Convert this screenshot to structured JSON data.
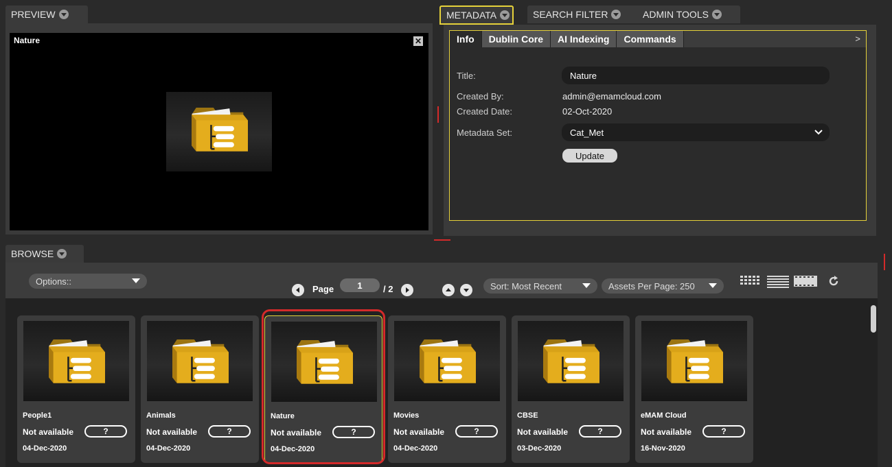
{
  "preview": {
    "tab_label": "PREVIEW",
    "asset_title": "Nature",
    "close_glyph": "✕"
  },
  "right_tabs": [
    {
      "label": "METADATA"
    },
    {
      "label": "SEARCH FILTER"
    },
    {
      "label": "ADMIN TOOLS"
    }
  ],
  "metadata": {
    "tabs": [
      {
        "label": "Info"
      },
      {
        "label": "Dublin Core"
      },
      {
        "label": "AI Indexing"
      },
      {
        "label": "Commands"
      }
    ],
    "more_arrow": ">",
    "fields": {
      "title_label": "Title:",
      "title_value": "Nature",
      "created_by_label": "Created By:",
      "created_by_value": "admin@emamcloud.com",
      "created_date_label": "Created Date:",
      "created_date_value": "02-Oct-2020",
      "metadata_set_label": "Metadata Set:",
      "metadata_set_value": "Cat_Met"
    },
    "update_label": "Update"
  },
  "browse": {
    "tab_label": "BROWSE",
    "options_label": "Options::",
    "page_label": "Page",
    "page_current": "1",
    "page_total": "/ 2",
    "sort_label": "Sort: Most Recent",
    "per_page_label": "Assets Per Page: 250"
  },
  "assets": [
    {
      "name": "People1",
      "status": "Not available",
      "rating": "?",
      "date": "04-Dec-2020"
    },
    {
      "name": "Animals",
      "status": "Not available",
      "rating": "?",
      "date": "04-Dec-2020"
    },
    {
      "name": "Nature",
      "status": "Not available",
      "rating": "?",
      "date": "04-Dec-2020"
    },
    {
      "name": "Movies",
      "status": "Not available",
      "rating": "?",
      "date": "04-Dec-2020"
    },
    {
      "name": "CBSE",
      "status": "Not available",
      "rating": "?",
      "date": "03-Dec-2020"
    },
    {
      "name": "eMAM Cloud",
      "status": "Not available",
      "rating": "?",
      "date": "16-Nov-2020"
    }
  ],
  "colors": {
    "highlight_yellow": "#e6d23a",
    "selection_red": "#d42a2a",
    "folder_gold": "#d4a017"
  }
}
